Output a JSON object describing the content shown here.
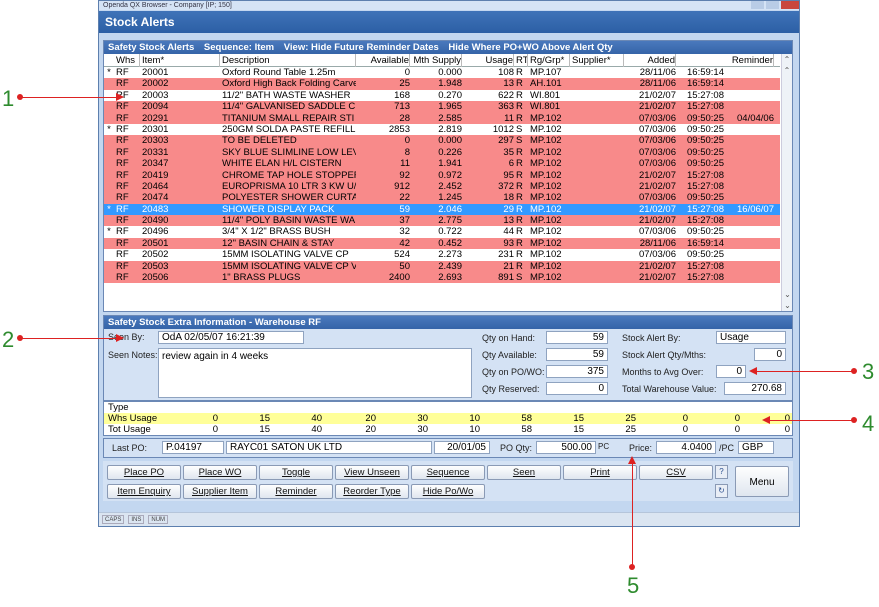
{
  "window": {
    "chrome_title": "Openda QX Browser - Company [IP; 150]",
    "title": "Stock Alerts"
  },
  "grid": {
    "header": {
      "title": "Safety Stock Alerts",
      "sequence": "Sequence: Item",
      "view": "View: Hide Future Reminder Dates",
      "hide": "Hide Where PO+WO Above Alert Qty"
    },
    "columns": [
      "Whs",
      "Item*",
      "Description",
      "Available",
      "Mth Supply",
      "Usage",
      "RT",
      "Rg/Grp*",
      "Supplier*",
      "Added",
      "",
      "Reminder"
    ],
    "rows": [
      {
        "mark": "*",
        "whs": "RF",
        "item": "20001",
        "desc": "Oxford Round Table 1.25m",
        "avail": "0",
        "mth": "0.000",
        "usage": "108",
        "rt": "R",
        "grp": "MP.107",
        "sup": "",
        "date": "28/11/06",
        "time": "16:59:14",
        "rem": "",
        "style": "w"
      },
      {
        "mark": "",
        "whs": "RF",
        "item": "20002",
        "desc": "Oxford High Back Folding Carver",
        "avail": "25",
        "mth": "1.948",
        "usage": "13",
        "rt": "R",
        "grp": "AH.101",
        "sup": "",
        "date": "28/11/06",
        "time": "16:59:14",
        "rem": "",
        "style": "r"
      },
      {
        "mark": "",
        "whs": "RF",
        "item": "20003",
        "desc": "11/2\" BATH WASTE WASHER",
        "avail": "168",
        "mth": "0.270",
        "usage": "622",
        "rt": "R",
        "grp": "WI.801",
        "sup": "",
        "date": "21/02/07",
        "time": "15:27:08",
        "rem": "",
        "style": "w"
      },
      {
        "mark": "",
        "whs": "RF",
        "item": "20094",
        "desc": "11/4\" GALVANISED SADDLE C",
        "avail": "713",
        "mth": "1.965",
        "usage": "363",
        "rt": "R",
        "grp": "WI.801",
        "sup": "",
        "date": "21/02/07",
        "time": "15:27:08",
        "rem": "",
        "style": "r"
      },
      {
        "mark": "",
        "whs": "RF",
        "item": "20291",
        "desc": "TITANIUM SMALL REPAIR STI",
        "avail": "28",
        "mth": "2.585",
        "usage": "11",
        "rt": "R",
        "grp": "MP.102",
        "sup": "",
        "date": "07/03/06",
        "time": "09:50:25",
        "rem": "04/04/06",
        "style": "r"
      },
      {
        "mark": "*",
        "whs": "RF",
        "item": "20301",
        "desc": "250GM SOLDA PASTE REFILL",
        "avail": "2853",
        "mth": "2.819",
        "usage": "1012",
        "rt": "S",
        "grp": "MP.102",
        "sup": "",
        "date": "07/03/06",
        "time": "09:50:25",
        "rem": "",
        "style": "w"
      },
      {
        "mark": "",
        "whs": "RF",
        "item": "20303",
        "desc": "TO BE DELETED",
        "avail": "0",
        "mth": "0.000",
        "usage": "297",
        "rt": "S",
        "grp": "MP.102",
        "sup": "",
        "date": "07/03/06",
        "time": "09:50:25",
        "rem": "",
        "style": "r"
      },
      {
        "mark": "",
        "whs": "RF",
        "item": "20331",
        "desc": "SKY BLUE SLIMLINE LOW LEV",
        "avail": "8",
        "mth": "0.226",
        "usage": "35",
        "rt": "R",
        "grp": "MP.102",
        "sup": "",
        "date": "07/03/06",
        "time": "09:50:25",
        "rem": "",
        "style": "r"
      },
      {
        "mark": "",
        "whs": "RF",
        "item": "20347",
        "desc": "WHITE ELAN H/L CISTERN",
        "avail": "11",
        "mth": "1.941",
        "usage": "6",
        "rt": "R",
        "grp": "MP.102",
        "sup": "",
        "date": "07/03/06",
        "time": "09:50:25",
        "rem": "",
        "style": "r"
      },
      {
        "mark": "",
        "whs": "RF",
        "item": "20419",
        "desc": "CHROME TAP HOLE STOPPEF",
        "avail": "92",
        "mth": "0.972",
        "usage": "95",
        "rt": "R",
        "grp": "MP.102",
        "sup": "",
        "date": "21/02/07",
        "time": "15:27:08",
        "rem": "",
        "style": "r"
      },
      {
        "mark": "",
        "whs": "RF",
        "item": "20464",
        "desc": "EUROPRISMA 10 LTR 3 KW U/",
        "avail": "912",
        "mth": "2.452",
        "usage": "372",
        "rt": "R",
        "grp": "MP.102",
        "sup": "",
        "date": "21/02/07",
        "time": "15:27:08",
        "rem": "",
        "style": "r"
      },
      {
        "mark": "",
        "whs": "RF",
        "item": "20474",
        "desc": "POLYESTER SHOWER CURTA",
        "avail": "22",
        "mth": "1.245",
        "usage": "18",
        "rt": "R",
        "grp": "MP.102",
        "sup": "",
        "date": "07/03/06",
        "time": "09:50:25",
        "rem": "",
        "style": "r"
      },
      {
        "mark": "*",
        "whs": "RF",
        "item": "20483",
        "desc": "SHOWER DISPLAY PACK",
        "avail": "59",
        "mth": "2.046",
        "usage": "29",
        "rt": "R",
        "grp": "MP.102",
        "sup": "",
        "date": "21/02/07",
        "time": "15:27:08",
        "rem": "16/06/07",
        "style": "s"
      },
      {
        "mark": "",
        "whs": "RF",
        "item": "20490",
        "desc": "11/4\" POLY BASIN WASTE WA",
        "avail": "37",
        "mth": "2.775",
        "usage": "13",
        "rt": "R",
        "grp": "MP.102",
        "sup": "",
        "date": "21/02/07",
        "time": "15:27:08",
        "rem": "",
        "style": "r"
      },
      {
        "mark": "*",
        "whs": "RF",
        "item": "20496",
        "desc": "3/4\" X 1/2\" BRASS BUSH",
        "avail": "32",
        "mth": "0.722",
        "usage": "44",
        "rt": "R",
        "grp": "MP.102",
        "sup": "",
        "date": "07/03/06",
        "time": "09:50:25",
        "rem": "",
        "style": "w"
      },
      {
        "mark": "",
        "whs": "RF",
        "item": "20501",
        "desc": "12\" BASIN CHAIN & STAY",
        "avail": "42",
        "mth": "0.452",
        "usage": "93",
        "rt": "R",
        "grp": "MP.102",
        "sup": "",
        "date": "28/11/06",
        "time": "16:59:14",
        "rem": "",
        "style": "r"
      },
      {
        "mark": "",
        "whs": "RF",
        "item": "20502",
        "desc": "15MM ISOLATING VALVE CP",
        "avail": "524",
        "mth": "2.273",
        "usage": "231",
        "rt": "R",
        "grp": "MP.102",
        "sup": "",
        "date": "07/03/06",
        "time": "09:50:25",
        "rem": "",
        "style": "w"
      },
      {
        "mark": "",
        "whs": "RF",
        "item": "20503",
        "desc": "15MM ISOLATING VALVE CP V",
        "avail": "50",
        "mth": "2.439",
        "usage": "21",
        "rt": "R",
        "grp": "MP.102",
        "sup": "",
        "date": "21/02/07",
        "time": "15:27:08",
        "rem": "",
        "style": "r"
      },
      {
        "mark": "",
        "whs": "RF",
        "item": "20506",
        "desc": "1\" BRASS PLUGS",
        "avail": "2400",
        "mth": "2.693",
        "usage": "891",
        "rt": "S",
        "grp": "MP.102",
        "sup": "",
        "date": "21/02/07",
        "time": "15:27:08",
        "rem": "",
        "style": "r"
      }
    ]
  },
  "extra": {
    "title": "Safety Stock Extra Information - Warehouse RF",
    "seen_by_label": "Seen By:",
    "seen_by_value": "OdA 02/05/07 16:21:39",
    "seen_notes_label": "Seen Notes:",
    "seen_notes_value": "review again in 4 weeks",
    "qty_on_hand_label": "Qty on Hand:",
    "qty_on_hand": "59",
    "qty_available_label": "Qty Available:",
    "qty_available": "59",
    "qty_on_po_label": "Qty on PO/WO:",
    "qty_on_po": "375",
    "qty_reserved_label": "Qty Reserved:",
    "qty_reserved": "0",
    "alert_by_label": "Stock Alert By:",
    "alert_by": "Usage",
    "alert_qty_label": "Stock Alert Qty/Mths:",
    "alert_qty": "0",
    "months_avg_label": "Months to Avg Over:",
    "months_avg": "0",
    "total_value_label": "Total Warehouse Value:",
    "total_value": "270.68"
  },
  "type_grid": {
    "type_label": "Type",
    "rows": [
      {
        "name": "Whs Usage",
        "values": [
          "0",
          "15",
          "40",
          "20",
          "30",
          "10",
          "58",
          "15",
          "25",
          "0",
          "0",
          "0"
        ]
      },
      {
        "name": "Tot Usage",
        "values": [
          "0",
          "15",
          "40",
          "20",
          "30",
          "10",
          "58",
          "15",
          "25",
          "0",
          "0",
          "0"
        ]
      }
    ]
  },
  "last_po": {
    "label": "Last PO:",
    "po_number": "P.04197",
    "supplier": "RAYC01 SATON UK LTD",
    "date": "20/01/05",
    "po_qty_label": "PO Qty:",
    "po_qty": "500.00",
    "po_unit": "PC",
    "price_label": "Price:",
    "price": "4.0400",
    "price_unit": "/PC",
    "currency": "GBP"
  },
  "buttons": {
    "place_po": "Place PO",
    "place_wo": "Place WO",
    "toggle": "Toggle",
    "view_unseen": "View Unseen",
    "sequence": "Sequence",
    "seen": "Seen",
    "print": "Print",
    "csv": "CSV",
    "item_enquiry": "Item Enquiry",
    "supplier_item": "Supplier Item",
    "reminder": "Reminder",
    "reorder_type": "Reorder Type",
    "hide_powo": "Hide Po/Wo",
    "menu": "Menu"
  },
  "status": [
    "CAPS",
    "INS",
    "NUM"
  ],
  "callouts": [
    "1",
    "2",
    "3",
    "4",
    "5"
  ],
  "colors": {
    "alert_row": "#f88a8a",
    "selected_row": "#3399ff",
    "usage_row": "#ffff99",
    "callout_text": "#2e8b2e",
    "callout_line": "#dd2222"
  }
}
